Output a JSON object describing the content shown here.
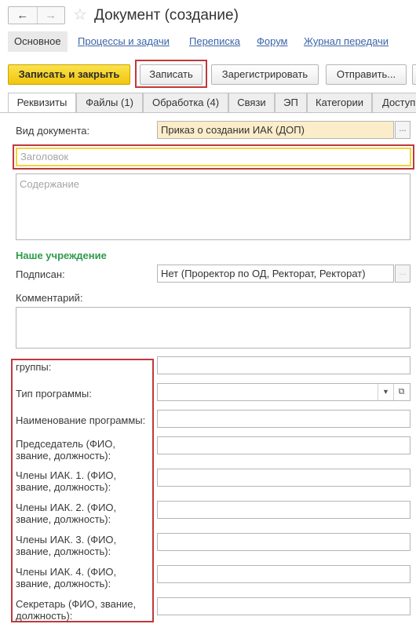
{
  "window": {
    "title": "Документ (создание)",
    "back_icon": "arrow-left-icon",
    "forward_icon": "arrow-right-icon",
    "favorite_icon": "star-icon"
  },
  "nav_links": [
    {
      "label": "Основное"
    },
    {
      "label": "Процессы и задачи"
    },
    {
      "label": "Переписка"
    },
    {
      "label": "Форум"
    },
    {
      "label": "Журнал передачи"
    }
  ],
  "toolbar": {
    "save_close_label": "Записать и закрыть",
    "save_label": "Записать",
    "register_label": "Зарегистрировать",
    "send_label": "Отправить..."
  },
  "tabs": [
    {
      "label": "Реквизиты"
    },
    {
      "label": "Файлы (1)"
    },
    {
      "label": "Обработка (4)"
    },
    {
      "label": "Связи"
    },
    {
      "label": "ЭП"
    },
    {
      "label": "Категории"
    },
    {
      "label": "Доступ"
    }
  ],
  "form": {
    "doc_type_label": "Вид документа:",
    "doc_type_value": "Приказ о создании ИАК (ДОП)",
    "header_placeholder": "Заголовок",
    "content_placeholder": "Содержание",
    "section_title": "Наше учреждение",
    "signed_label": "Подписан:",
    "signed_value": "Нет (Проректор по ОД, Ректорат, Ректорат)",
    "comment_label": "Комментарий:",
    "ellipsis": "..."
  },
  "custom_fields": [
    {
      "label": "группы:"
    },
    {
      "label": "Тип программы:"
    },
    {
      "label": "Наименование программы:"
    },
    {
      "label": "Председатель (ФИО,\nзвание, должность):"
    },
    {
      "label": "Члены ИАК. 1. (ФИО,\nзвание, должность):"
    },
    {
      "label": "Члены ИАК. 2. (ФИО,\nзвание, должность):"
    },
    {
      "label": "Члены ИАК. 3. (ФИО,\nзвание, должность):"
    },
    {
      "label": "Члены ИАК. 4. (ФИО,\nзвание, должность):"
    },
    {
      "label": "Секретарь (ФИО, звание,\nдолжность):"
    }
  ],
  "colors": {
    "primary_button": "#f1c50c",
    "highlight_red": "#c0393b",
    "section_green": "#2f9b4b",
    "link_blue": "#3b64a8"
  }
}
